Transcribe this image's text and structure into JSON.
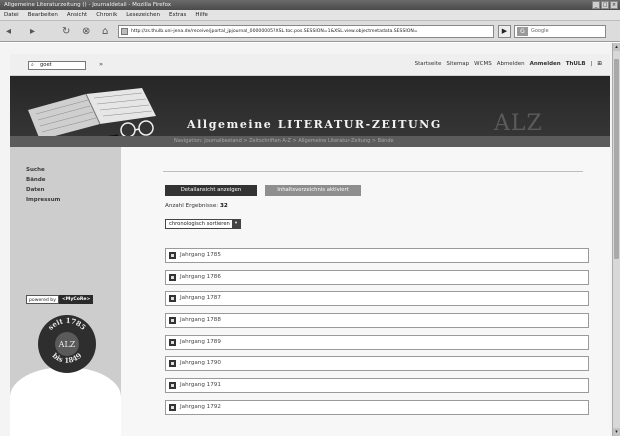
{
  "browser": {
    "title": "Allgemeine Literaturzeitung () - Journaldetail - Mozilla Firefox",
    "window_buttons": [
      "_",
      "□",
      "×"
    ],
    "menu": [
      "Datei",
      "Bearbeiten",
      "Ansicht",
      "Chronik",
      "Lesezeichen",
      "Extras",
      "Hilfe"
    ],
    "nav": {
      "back": "◂",
      "forward": "▸",
      "reload": "↻",
      "stop": "⊗",
      "home": "⌂"
    },
    "url": "http://zs.thulb.uni-jena.de/receive/jportal_jpjournal_00000005?XSL.toc.pos.SESSION=1&XSL.view.objectmetadata.SESSION=",
    "go": "▶",
    "search_placeholder": "Google",
    "search_logo": "G"
  },
  "site": {
    "search_value": "goet",
    "search_go": "»",
    "toplinks": [
      "Startseite",
      "Sitemap",
      "WCMS",
      "Abmelden",
      "Anmelden",
      "ThULB",
      "|",
      "⊞"
    ],
    "toplinks_bold": [
      false,
      false,
      false,
      false,
      true,
      true,
      false,
      true
    ],
    "masthead": "Allgemeine LITERATUR-ZEITUNG",
    "masthead_abbrev": "ALZ",
    "breadcrumb": "Navigation: Journalbestand > Zeitschriften A-Z > Allgemeine Literatur-Zeitung > Bände",
    "sidebar": {
      "nav": [
        "Suche",
        "Bände",
        "Daten",
        "Impressum"
      ],
      "powered_left": "powered by",
      "powered_right": "<MyCoRe>",
      "seal_top": "seit 1785",
      "seal_center": "ALZ",
      "seal_bottom": "bis 1849"
    },
    "main": {
      "btn_detail": "Detailansicht anzeigen",
      "btn_toc": "Inhaltsverzeichnis aktiviert",
      "count_label": "Anzahl Ergebnisse:",
      "count_value": "32",
      "sort_label": "chronologisch sortieren",
      "sort_arrow": "▾",
      "volumes": [
        "Jahrgang 1785",
        "Jahrgang 1786",
        "Jahrgang 1787",
        "Jahrgang 1788",
        "Jahrgang 1789",
        "Jahrgang 1790",
        "Jahrgang 1791",
        "Jahrgang 1792"
      ]
    }
  }
}
